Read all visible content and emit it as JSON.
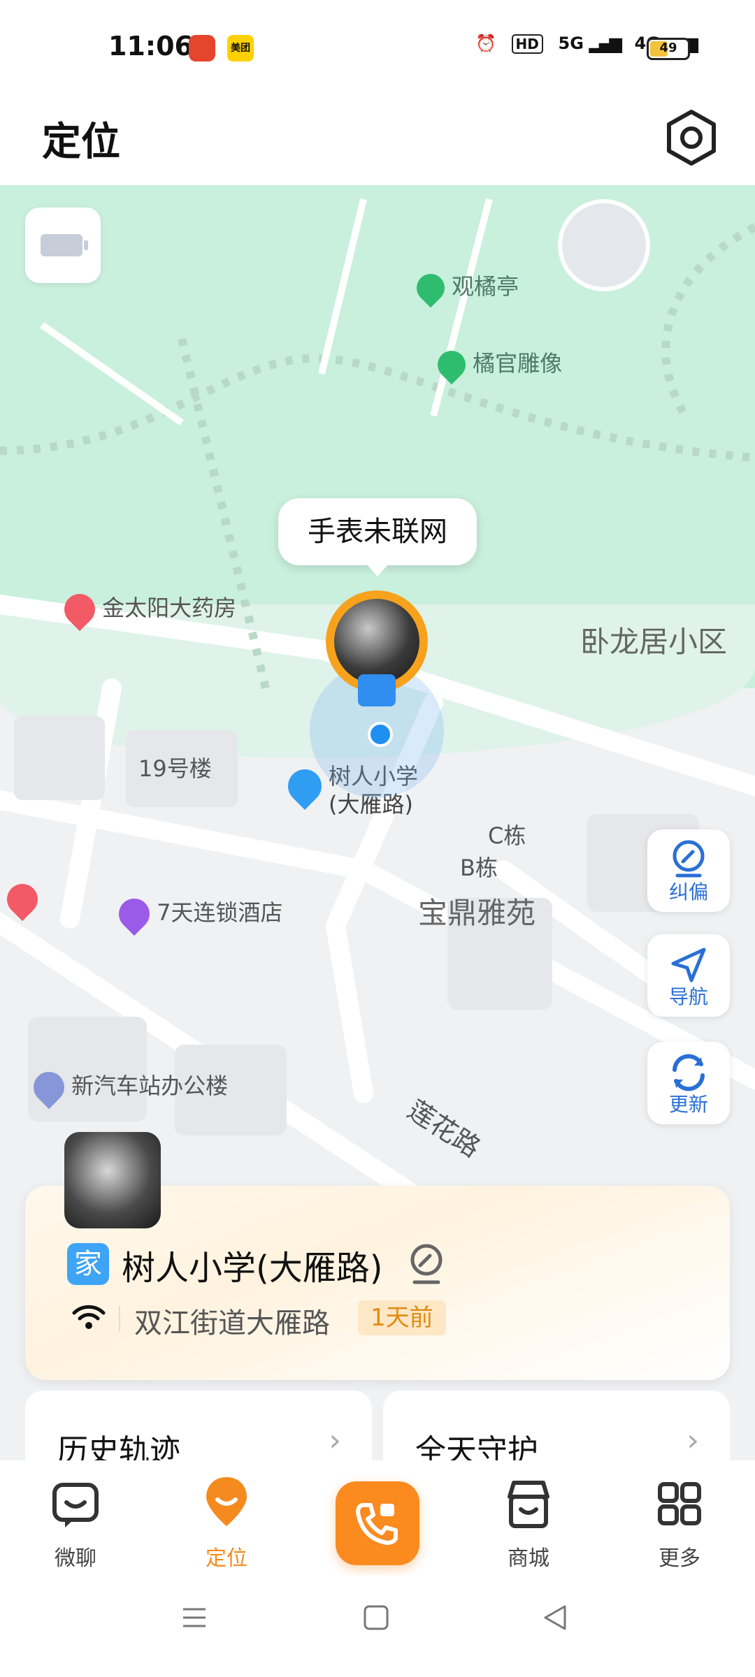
{
  "status_bar": {
    "time": "11:06",
    "brand_app_1": "",
    "brand_app_2": "美团",
    "network_1": "HD",
    "network_2": "5G",
    "network_3": "4G",
    "battery_level": "49"
  },
  "header": {
    "title": "定位",
    "settings_icon": "gear-icon"
  },
  "map": {
    "watch_status_bubble": "手表未联网",
    "pois": [
      {
        "label": "观橘亭",
        "icon": "park-icon"
      },
      {
        "label": "橘官雕像",
        "icon": "park-icon"
      },
      {
        "label": "金太阳大药房",
        "icon": "pharmacy-icon"
      },
      {
        "label": "卧龙居小区",
        "icon": ""
      },
      {
        "label": "19号楼",
        "icon": ""
      },
      {
        "label": "树人小学\n(大雁路)",
        "icon": "school-icon"
      },
      {
        "label": "C栋",
        "icon": ""
      },
      {
        "label": "B栋",
        "icon": ""
      },
      {
        "label": "宝鼎雅苑",
        "icon": ""
      },
      {
        "label": "7天连锁酒店",
        "icon": "hotel-icon"
      },
      {
        "label": "新汽车站办公楼",
        "icon": "office-icon"
      },
      {
        "label": "莲花路",
        "icon": ""
      }
    ],
    "side_buttons": {
      "correct": "纠偏",
      "navigate": "导航",
      "refresh": "更新"
    },
    "colors": {
      "park": "#c9efdd",
      "accent": "#f58b1f",
      "blue": "#2a6fd6"
    }
  },
  "location_card": {
    "tag": "家",
    "place": "树人小学(大雁路)",
    "street": "双江街道大雁路",
    "ago": "1天前"
  },
  "tiles": {
    "history": "历史轨迹",
    "guard": "全天守护"
  },
  "bottom_nav": {
    "chat": "微聊",
    "locate": "定位",
    "mall": "商城",
    "more": "更多"
  }
}
